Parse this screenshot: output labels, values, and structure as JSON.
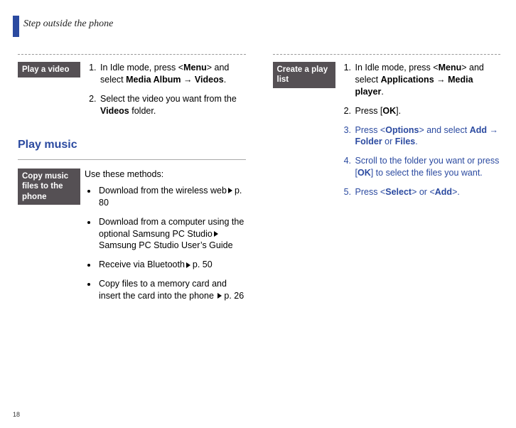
{
  "header": {
    "title": "Step outside the phone"
  },
  "page_number": "18",
  "left": {
    "play_video": {
      "label": "Play a video",
      "step1_a": "In Idle mode, press <",
      "step1_menu": "Menu",
      "step1_b": "> and select ",
      "step1_media_album": "Media Album",
      "step1_arrow": " → ",
      "step1_videos": "Videos",
      "step1_c": ".",
      "step2_a": "Select the video you want from the ",
      "step2_videos": "Videos",
      "step2_b": " folder."
    },
    "play_music_heading": "Play music",
    "copy_music": {
      "label": "Copy music files to the phone",
      "intro": "Use these methods:",
      "b1_a": "Download from the wireless web",
      "b1_ref": "p. 80",
      "b2_a": "Download from a computer using the optional Samsung PC Studio",
      "b2_ref": "Samsung PC Studio User’s Guide",
      "b3_a": "Receive via Bluetooth",
      "b3_ref": "p. 50",
      "b4_a": "Copy files to a memory card and insert the card into the phone ",
      "b4_ref": "p. 26"
    }
  },
  "right": {
    "create_playlist": {
      "label": "Create a play list",
      "s1_a": "In Idle mode, press <",
      "s1_menu": "Menu",
      "s1_b": "> and select ",
      "s1_apps": "Applications",
      "s1_arrow": " → ",
      "s1_media_player": "Media player",
      "s1_c": ".",
      "s2_a": "Press [",
      "s2_ok": "OK",
      "s2_b": "].",
      "s3_a": "Press <",
      "s3_options": "Options",
      "s3_b": "> and select ",
      "s3_add": "Add",
      "s3_arrow": " → ",
      "s3_folder": "Folder",
      "s3_or": " or ",
      "s3_files": "Files",
      "s3_c": ".",
      "s4_a": "Scroll to the folder you want or press [",
      "s4_ok": "OK",
      "s4_b": "] to select the files you want.",
      "s5_a": "Press <",
      "s5_select": "Select",
      "s5_b": "> or <",
      "s5_add": "Add",
      "s5_c": ">."
    }
  }
}
